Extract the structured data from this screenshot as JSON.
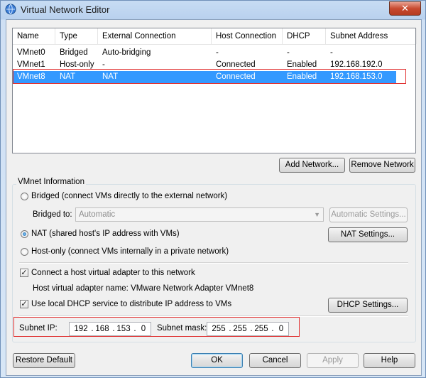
{
  "window": {
    "title": "Virtual Network Editor",
    "close_glyph": "✕"
  },
  "list": {
    "columns": [
      "Name",
      "Type",
      "External Connection",
      "Host Connection",
      "DHCP",
      "Subnet Address"
    ],
    "rows": [
      [
        "VMnet0",
        "Bridged",
        "Auto-bridging",
        "-",
        "-",
        "-"
      ],
      [
        "VMnet1",
        "Host-only",
        "-",
        "Connected",
        "Enabled",
        "192.168.192.0"
      ],
      [
        "VMnet8",
        "NAT",
        "NAT",
        "Connected",
        "Enabled",
        "192.168.153.0"
      ]
    ],
    "selected_index": 2
  },
  "buttons": {
    "add_network": "Add Network...",
    "remove_network": "Remove Network",
    "automatic_settings": "Automatic Settings...",
    "nat_settings": "NAT Settings...",
    "dhcp_settings": "DHCP Settings...",
    "restore_default": "Restore Default",
    "ok": "OK",
    "cancel": "Cancel",
    "apply": "Apply",
    "help": "Help"
  },
  "vmnet_info": {
    "group_title": "VMnet Information",
    "bridged_label": "Bridged (connect VMs directly to the external network)",
    "bridged_to_label": "Bridged to:",
    "bridged_to_value": "Automatic",
    "nat_label": "NAT (shared host's IP address with VMs)",
    "hostonly_label": "Host-only (connect VMs internally in a private network)",
    "connect_adapter_label": "Connect a host virtual adapter to this network",
    "adapter_name_text": "Host virtual adapter name: VMware Network Adapter VMnet8",
    "use_dhcp_label": "Use local DHCP service to distribute IP address to VMs",
    "selected_mode": "NAT",
    "connect_adapter_checked": true,
    "use_dhcp_checked": true
  },
  "subnet": {
    "ip_label": "Subnet IP:",
    "ip": [
      "192",
      "168",
      "153",
      "0"
    ],
    "mask_label": "Subnet mask:",
    "mask": [
      "255",
      "255",
      "255",
      "0"
    ]
  },
  "colors": {
    "selection": "#3399ff",
    "highlight_outline": "#e03030"
  }
}
